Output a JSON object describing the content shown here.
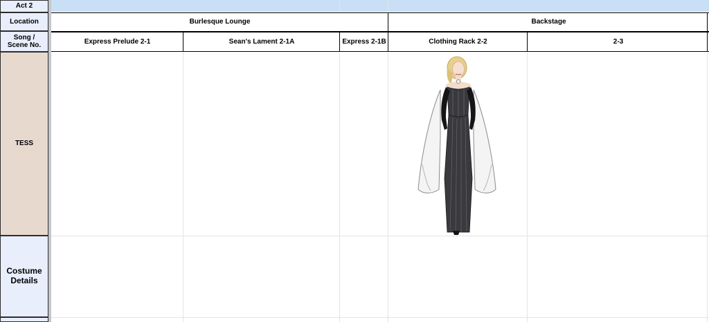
{
  "labels": {
    "act": "Act 2",
    "location": "Location",
    "song_scene": "Song / Scene No.",
    "character": "TESS",
    "costume_details": "Costume Details"
  },
  "locations": [
    "Burlesque Lounge",
    "Backstage"
  ],
  "scenes": [
    "Express Prelude 2-1",
    "Sean's Lament 2-1A",
    "Express 2-1B",
    "Clothing Rack 2-2",
    "2-3"
  ],
  "colors": {
    "top_band": "#c9dff5",
    "label_fill": "#e8eefb",
    "character_fill": "#e8d9cf",
    "gown": "#3a3a3e",
    "cape": "#f4f4f4",
    "hair": "#e8cf8a"
  }
}
